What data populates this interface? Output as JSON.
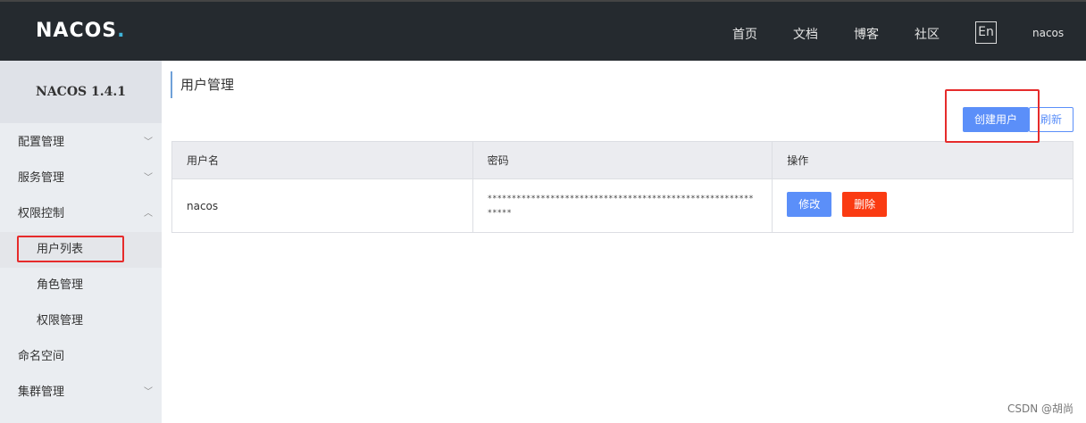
{
  "header": {
    "logo_text": "NAC",
    "logo_text_2": "OS",
    "logo_dot": ".",
    "nav": [
      "首页",
      "文档",
      "博客",
      "社区"
    ],
    "lang": "En",
    "user": "nacos"
  },
  "sidebar": {
    "version": "NACOS 1.4.1",
    "items": [
      {
        "label": "配置管理"
      },
      {
        "label": "服务管理"
      },
      {
        "label": "权限控制"
      },
      {
        "label": "用户列表"
      },
      {
        "label": "角色管理"
      },
      {
        "label": "权限管理"
      },
      {
        "label": "命名空间"
      },
      {
        "label": "集群管理"
      }
    ]
  },
  "main": {
    "title": "用户管理",
    "create_button": "创建用户",
    "refresh_button": "刷新",
    "table": {
      "headers": [
        "用户名",
        "密码",
        "操作"
      ],
      "rows": [
        {
          "username": "nacos",
          "password": "************************************************************",
          "edit": "修改",
          "delete": "删除"
        }
      ]
    }
  },
  "watermark": "CSDN @胡尚",
  "colors": {
    "topbar": "#252a2f",
    "primary": "#5b8ff9",
    "danger": "#fa3b12",
    "highlight": "#e62b2b"
  }
}
